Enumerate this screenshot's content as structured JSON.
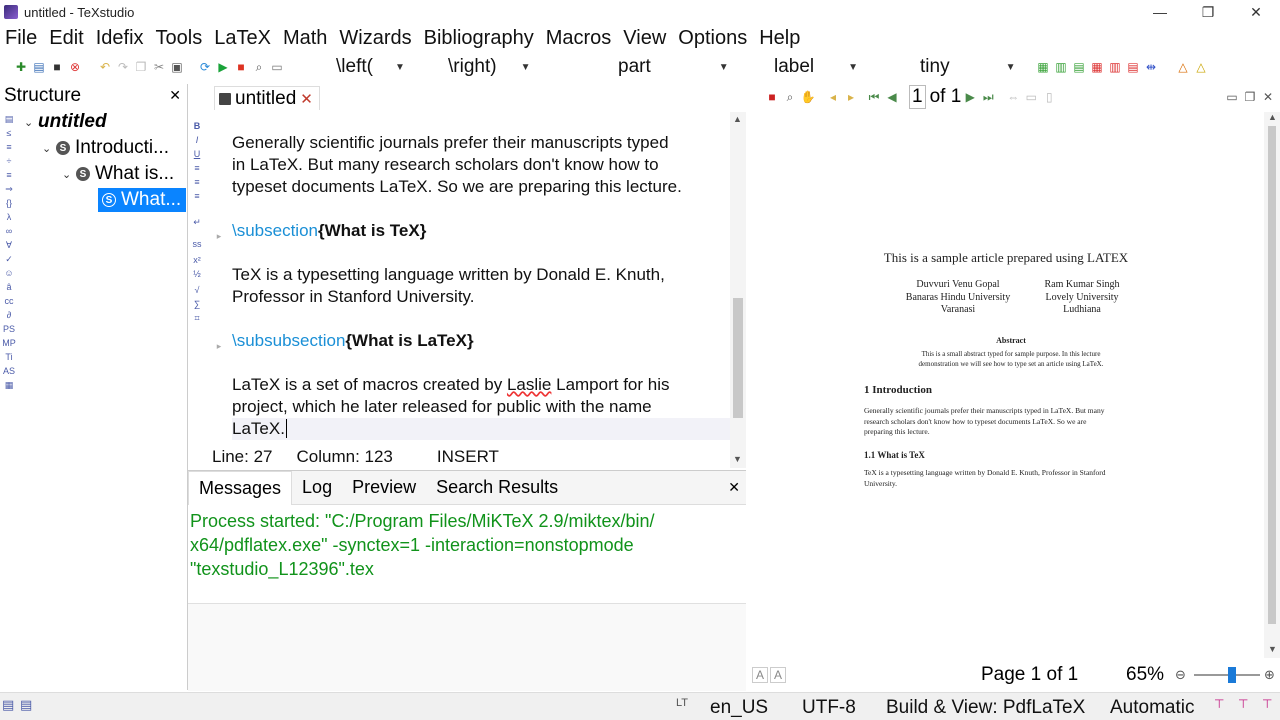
{
  "window": {
    "title": "untitled - TeXstudio",
    "minimize": "—",
    "maximize": "❐",
    "close": "✕"
  },
  "menu": [
    "File",
    "Edit",
    "Idefix",
    "Tools",
    "LaTeX",
    "Math",
    "Wizards",
    "Bibliography",
    "Macros",
    "View",
    "Options",
    "Help"
  ],
  "toolbar": {
    "left_delim": "\\left(",
    "right_delim": "\\right)",
    "sectioning": "part",
    "reference": "label",
    "size": "tiny"
  },
  "structure": {
    "title": "Structure",
    "close": "✕",
    "tree": [
      {
        "label": "untitled"
      },
      {
        "label": "Introducti..."
      },
      {
        "label": "What is..."
      },
      {
        "label": "What..."
      }
    ]
  },
  "editor": {
    "tab": "untitled",
    "tab_close": "✕",
    "lines": {
      "p1": [
        "Generally scientific journals prefer their manuscripts typed",
        "in LaTeX. But many research scholars don't know how to",
        "typeset documents LaTeX. So we are preparing this lecture."
      ],
      "sub_cmd": "\\subsection",
      "sub_arg": "{What is TeX}",
      "p2": [
        "TeX is a typesetting language written by Donald E. Knuth,",
        "Professor in Stanford University."
      ],
      "subsub_cmd": "\\subsubsection",
      "subsub_arg": "{What is LaTeX}",
      "p3_a": "LaTeX is a set of macros created by ",
      "p3_b": "Laslie",
      "p3_c": " Lamport for his",
      "p3_line2": "project, which he later released for public with the name",
      "p3_line3": "LaTeX."
    },
    "status": {
      "line": "Line: 27",
      "column": "Column: 123",
      "mode": "INSERT"
    }
  },
  "messages": {
    "tabs": [
      "Messages",
      "Log",
      "Preview",
      "Search Results"
    ],
    "close": "✕",
    "text": "Process started: \"C:/Program Files/MiKTeX 2.9/miktex/bin/\nx64/pdflatex.exe\" -synctex=1 -interaction=nonstopmode\n\"texstudio_L12396\".tex"
  },
  "pdf": {
    "page_input": "1",
    "page_of": "of 1",
    "title": "This is a sample article prepared using LATEX",
    "author1": [
      "Duvvuri Venu Gopal",
      "Banaras Hindu University",
      "Varanasi"
    ],
    "author2": [
      "Ram Kumar Singh",
      "Lovely University",
      "Ludhiana"
    ],
    "abstract_title": "Abstract",
    "abstract": [
      "This is a small abstract typed for sample purpose.  In this lecture",
      "demonstration we will see how to type set an article using LaTeX."
    ],
    "sec1": "1   Introduction",
    "sec1_text": [
      "Generally scientific journals prefer their manuscripts typed in LaTeX. But many",
      "research scholars don't know how to typeset documents LaTeX. So we are",
      "preparing this lecture."
    ],
    "sec11": "1.1   What is TeX",
    "sec11_text": [
      "TeX is a typesetting language written by Donald E. Knuth, Professor in Stanford",
      "University."
    ],
    "page_status": "Page 1 of 1",
    "zoom": "65%",
    "zoom_level": 0.55
  },
  "statusbar": {
    "language": "en_US",
    "encoding": "UTF-8",
    "build": "Build & View: PdfLaTeX",
    "mode": "Automatic"
  },
  "colors": {
    "command": "#1a8fd6",
    "message": "#11931b",
    "selection": "#0a84ff"
  }
}
